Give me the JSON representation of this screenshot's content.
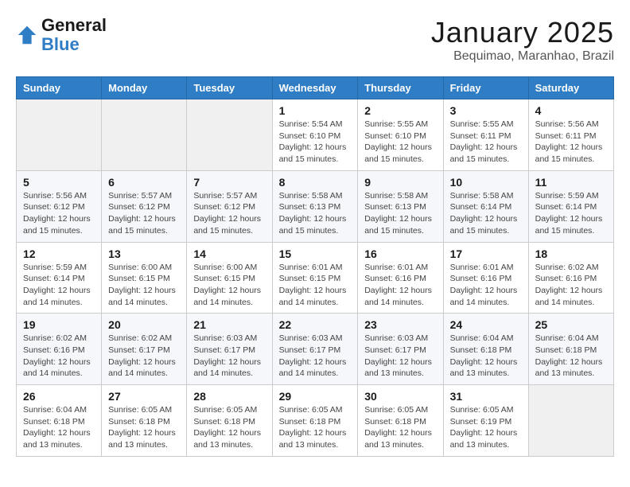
{
  "header": {
    "logo_line1": "General",
    "logo_line2": "Blue",
    "month": "January 2025",
    "location": "Bequimao, Maranhao, Brazil"
  },
  "days_of_week": [
    "Sunday",
    "Monday",
    "Tuesday",
    "Wednesday",
    "Thursday",
    "Friday",
    "Saturday"
  ],
  "weeks": [
    [
      {
        "day": "",
        "info": ""
      },
      {
        "day": "",
        "info": ""
      },
      {
        "day": "",
        "info": ""
      },
      {
        "day": "1",
        "info": "Sunrise: 5:54 AM\nSunset: 6:10 PM\nDaylight: 12 hours\nand 15 minutes."
      },
      {
        "day": "2",
        "info": "Sunrise: 5:55 AM\nSunset: 6:10 PM\nDaylight: 12 hours\nand 15 minutes."
      },
      {
        "day": "3",
        "info": "Sunrise: 5:55 AM\nSunset: 6:11 PM\nDaylight: 12 hours\nand 15 minutes."
      },
      {
        "day": "4",
        "info": "Sunrise: 5:56 AM\nSunset: 6:11 PM\nDaylight: 12 hours\nand 15 minutes."
      }
    ],
    [
      {
        "day": "5",
        "info": "Sunrise: 5:56 AM\nSunset: 6:12 PM\nDaylight: 12 hours\nand 15 minutes."
      },
      {
        "day": "6",
        "info": "Sunrise: 5:57 AM\nSunset: 6:12 PM\nDaylight: 12 hours\nand 15 minutes."
      },
      {
        "day": "7",
        "info": "Sunrise: 5:57 AM\nSunset: 6:12 PM\nDaylight: 12 hours\nand 15 minutes."
      },
      {
        "day": "8",
        "info": "Sunrise: 5:58 AM\nSunset: 6:13 PM\nDaylight: 12 hours\nand 15 minutes."
      },
      {
        "day": "9",
        "info": "Sunrise: 5:58 AM\nSunset: 6:13 PM\nDaylight: 12 hours\nand 15 minutes."
      },
      {
        "day": "10",
        "info": "Sunrise: 5:58 AM\nSunset: 6:14 PM\nDaylight: 12 hours\nand 15 minutes."
      },
      {
        "day": "11",
        "info": "Sunrise: 5:59 AM\nSunset: 6:14 PM\nDaylight: 12 hours\nand 15 minutes."
      }
    ],
    [
      {
        "day": "12",
        "info": "Sunrise: 5:59 AM\nSunset: 6:14 PM\nDaylight: 12 hours\nand 14 minutes."
      },
      {
        "day": "13",
        "info": "Sunrise: 6:00 AM\nSunset: 6:15 PM\nDaylight: 12 hours\nand 14 minutes."
      },
      {
        "day": "14",
        "info": "Sunrise: 6:00 AM\nSunset: 6:15 PM\nDaylight: 12 hours\nand 14 minutes."
      },
      {
        "day": "15",
        "info": "Sunrise: 6:01 AM\nSunset: 6:15 PM\nDaylight: 12 hours\nand 14 minutes."
      },
      {
        "day": "16",
        "info": "Sunrise: 6:01 AM\nSunset: 6:16 PM\nDaylight: 12 hours\nand 14 minutes."
      },
      {
        "day": "17",
        "info": "Sunrise: 6:01 AM\nSunset: 6:16 PM\nDaylight: 12 hours\nand 14 minutes."
      },
      {
        "day": "18",
        "info": "Sunrise: 6:02 AM\nSunset: 6:16 PM\nDaylight: 12 hours\nand 14 minutes."
      }
    ],
    [
      {
        "day": "19",
        "info": "Sunrise: 6:02 AM\nSunset: 6:16 PM\nDaylight: 12 hours\nand 14 minutes."
      },
      {
        "day": "20",
        "info": "Sunrise: 6:02 AM\nSunset: 6:17 PM\nDaylight: 12 hours\nand 14 minutes."
      },
      {
        "day": "21",
        "info": "Sunrise: 6:03 AM\nSunset: 6:17 PM\nDaylight: 12 hours\nand 14 minutes."
      },
      {
        "day": "22",
        "info": "Sunrise: 6:03 AM\nSunset: 6:17 PM\nDaylight: 12 hours\nand 14 minutes."
      },
      {
        "day": "23",
        "info": "Sunrise: 6:03 AM\nSunset: 6:17 PM\nDaylight: 12 hours\nand 13 minutes."
      },
      {
        "day": "24",
        "info": "Sunrise: 6:04 AM\nSunset: 6:18 PM\nDaylight: 12 hours\nand 13 minutes."
      },
      {
        "day": "25",
        "info": "Sunrise: 6:04 AM\nSunset: 6:18 PM\nDaylight: 12 hours\nand 13 minutes."
      }
    ],
    [
      {
        "day": "26",
        "info": "Sunrise: 6:04 AM\nSunset: 6:18 PM\nDaylight: 12 hours\nand 13 minutes."
      },
      {
        "day": "27",
        "info": "Sunrise: 6:05 AM\nSunset: 6:18 PM\nDaylight: 12 hours\nand 13 minutes."
      },
      {
        "day": "28",
        "info": "Sunrise: 6:05 AM\nSunset: 6:18 PM\nDaylight: 12 hours\nand 13 minutes."
      },
      {
        "day": "29",
        "info": "Sunrise: 6:05 AM\nSunset: 6:18 PM\nDaylight: 12 hours\nand 13 minutes."
      },
      {
        "day": "30",
        "info": "Sunrise: 6:05 AM\nSunset: 6:18 PM\nDaylight: 12 hours\nand 13 minutes."
      },
      {
        "day": "31",
        "info": "Sunrise: 6:05 AM\nSunset: 6:19 PM\nDaylight: 12 hours\nand 13 minutes."
      },
      {
        "day": "",
        "info": ""
      }
    ]
  ]
}
